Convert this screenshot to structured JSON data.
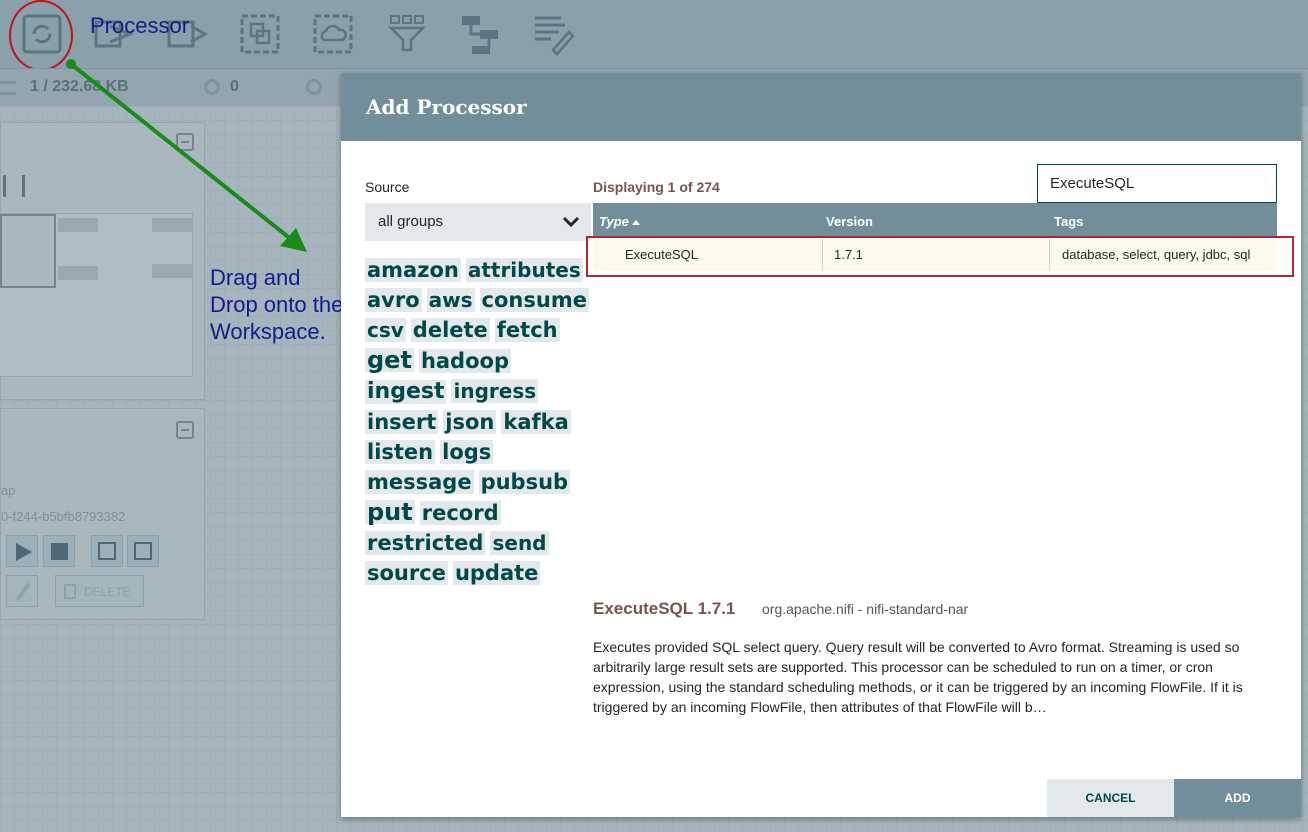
{
  "toolbar": {
    "icons": [
      "processor-icon",
      "input-port-icon",
      "output-port-icon",
      "process-group-icon",
      "remote-process-group-icon",
      "funnel-icon",
      "template-icon",
      "label-icon"
    ]
  },
  "status_bar": {
    "queued": "1 / 232.68 KB",
    "transmitting": "0"
  },
  "background_panels": {
    "id_fragment": "0-f244-b5bfb8793382",
    "group_fragment": "ap",
    "delete_label": "DELETE"
  },
  "annotations": {
    "processor_label": "Processor",
    "drag_line1": "Drag and",
    "drag_line2": "Drop onto the",
    "drag_line3": "Workspace.",
    "arrow_color": "#1a8a1a",
    "circle_color": "#c0121a"
  },
  "dialog": {
    "title": "Add Processor",
    "source_label": "Source",
    "source_value": "all groups",
    "tags": [
      {
        "label": "amazon",
        "size": 21
      },
      {
        "label": "attributes",
        "size": 20
      },
      {
        "label": "avro",
        "size": 21
      },
      {
        "label": "aws",
        "size": 20
      },
      {
        "label": "consume",
        "size": 21
      },
      {
        "label": "csv",
        "size": 20
      },
      {
        "label": "delete",
        "size": 21
      },
      {
        "label": "fetch",
        "size": 21
      },
      {
        "label": "get",
        "size": 24
      },
      {
        "label": "hadoop",
        "size": 21
      },
      {
        "label": "ingest",
        "size": 22
      },
      {
        "label": "ingress",
        "size": 20
      },
      {
        "label": "insert",
        "size": 21
      },
      {
        "label": "json",
        "size": 21
      },
      {
        "label": "kafka",
        "size": 21
      },
      {
        "label": "listen",
        "size": 21
      },
      {
        "label": "logs",
        "size": 21
      },
      {
        "label": "message",
        "size": 21
      },
      {
        "label": "pubsub",
        "size": 21
      },
      {
        "label": "put",
        "size": 24
      },
      {
        "label": "record",
        "size": 21
      },
      {
        "label": "restricted",
        "size": 21
      },
      {
        "label": "send",
        "size": 20
      },
      {
        "label": "source",
        "size": 21
      },
      {
        "label": "update",
        "size": 21
      }
    ],
    "displaying": "Displaying 1 of 274",
    "filter_value": "ExecuteSQL",
    "columns": {
      "type": "Type",
      "version": "Version",
      "tags": "Tags"
    },
    "rows": [
      {
        "type": "ExecuteSQL",
        "version": "1.7.1",
        "tags": "database, select, query, jdbc, sql"
      }
    ],
    "detail": {
      "name": "ExecuteSQL 1.7.1",
      "bundle": "org.apache.nifi - nifi-standard-nar",
      "description": "Executes provided SQL select query. Query result will be converted to Avro format. Streaming is used so arbitrarily large result sets are supported. This processor can be scheduled to run on a timer, or cron expression, using the standard scheduling methods, or it can be triggered by an incoming FlowFile. If it is triggered by an incoming FlowFile, then attributes of that FlowFile will b…"
    },
    "cancel_label": "CANCEL",
    "add_label": "ADD",
    "colors": {
      "header": "#728e9b",
      "accent_text": "#775351",
      "tag_text": "#004849",
      "row_highlight": "#b3282d"
    }
  }
}
